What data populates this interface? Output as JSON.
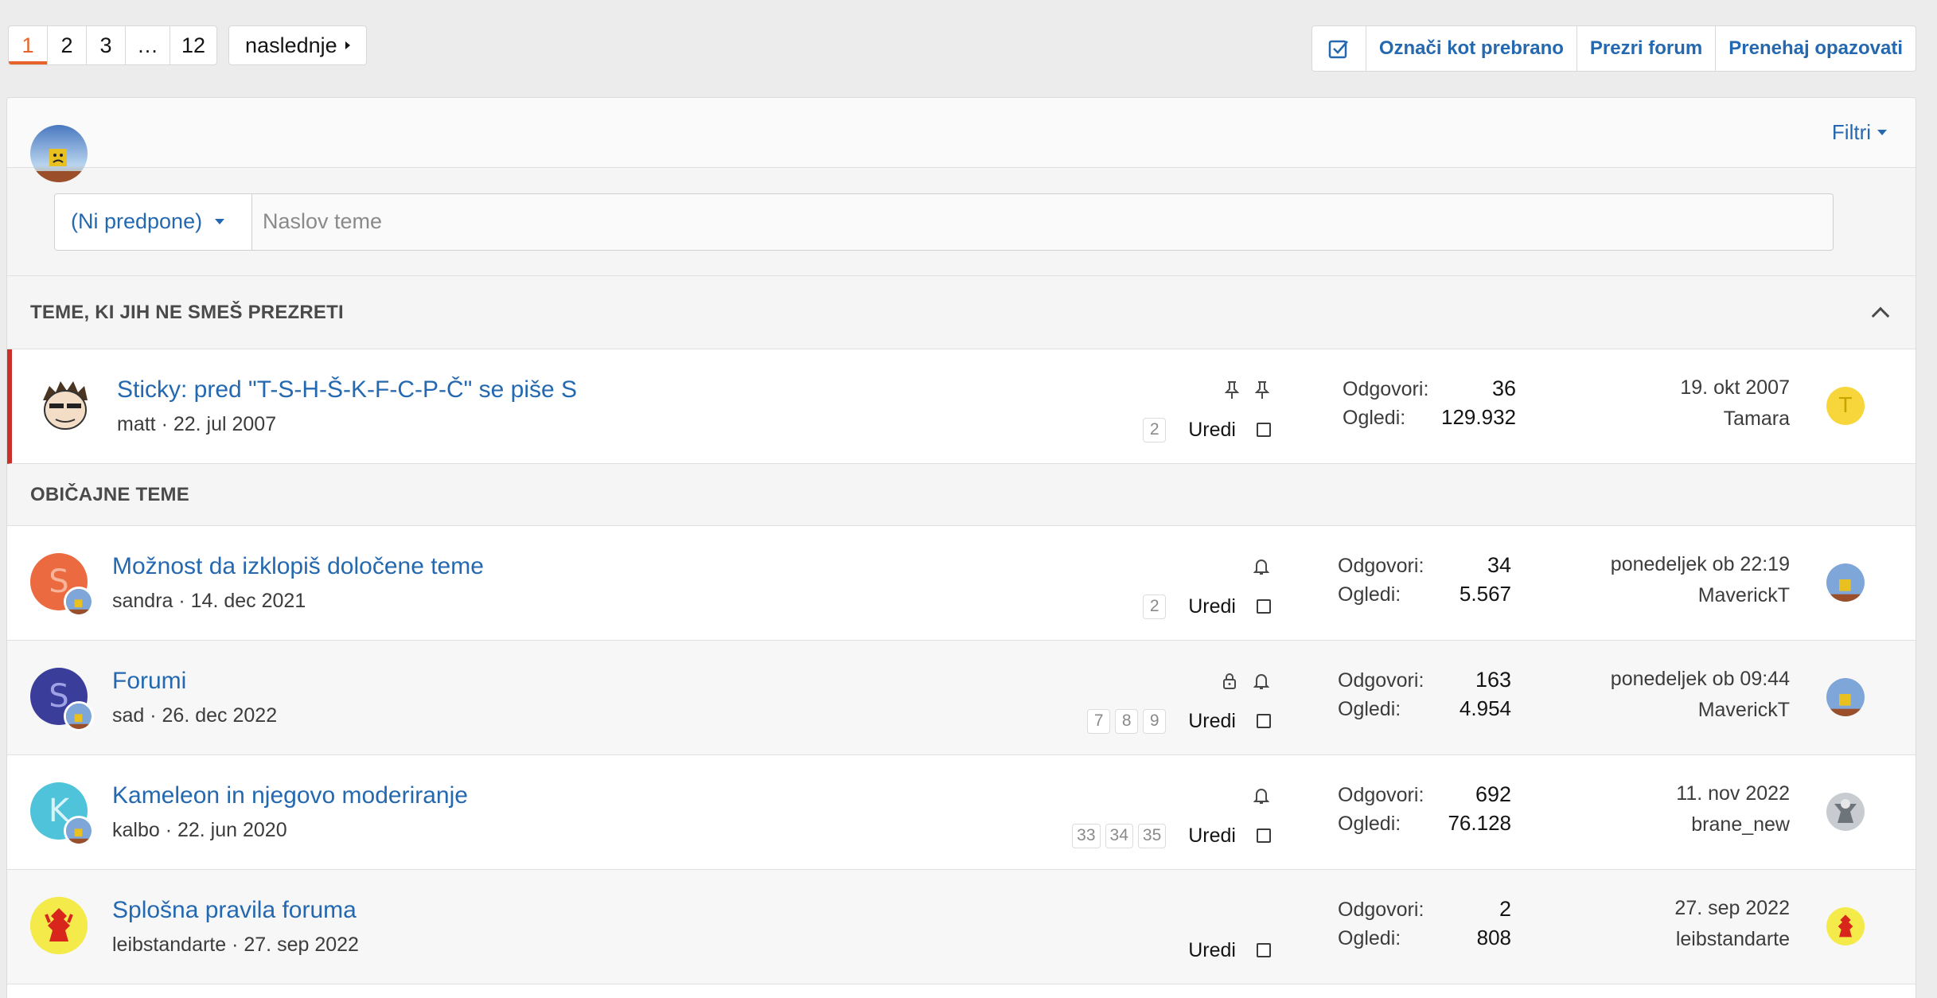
{
  "pagination": {
    "pages": [
      "1",
      "2",
      "3",
      "…",
      "12"
    ],
    "current": "1",
    "next_label": "naslednje"
  },
  "actions": {
    "mark_read": "Označi kot prebrano",
    "ignore_forum": "Prezri forum",
    "unwatch": "Prenehaj opazovati"
  },
  "filters_label": "Filtri",
  "quick_thread": {
    "prefix": "(Ni predpone)",
    "title_placeholder": "Naslov teme"
  },
  "sections": {
    "sticky_heading": "TEME, KI JIH NE SMEŠ PREZRETI",
    "normal_heading": "OBIČAJNE TEME"
  },
  "stat_labels": {
    "replies": "Odgovori:",
    "views": "Ogledi:"
  },
  "edit_label": "Uredi",
  "threads": [
    {
      "title": "Sticky: pred \"T-S-H-Š-K-F-C-P-Č\" se piše S",
      "author": "matt",
      "date": "22. jul 2007",
      "meta": "matt · 22. jul 2007",
      "pages": [
        "2"
      ],
      "replies": "36",
      "views": "129.932",
      "last_date": "19. okt 2007",
      "last_user": "Tamara",
      "last_avatar_letter": "T",
      "icons": [
        "pin-icon",
        "pin-icon"
      ]
    },
    {
      "title": "Možnost da izklopiš določene teme",
      "author": "sandra",
      "date": "14. dec 2021",
      "meta": "sandra · 14. dec 2021",
      "avatar_letter": "S",
      "avatar_color": "#ec6a3f",
      "pages": [
        "2"
      ],
      "replies": "34",
      "views": "5.567",
      "last_date": "ponedeljek ob 22:19",
      "last_user": "MaverickT",
      "icons": [
        "bell-icon"
      ]
    },
    {
      "title": "Forumi",
      "author": "sad",
      "date": "26. dec 2022",
      "meta": "sad · 26. dec 2022",
      "avatar_letter": "S",
      "avatar_color": "#3b3d9a",
      "pages": [
        "7",
        "8",
        "9"
      ],
      "replies": "163",
      "views": "4.954",
      "last_date": "ponedeljek ob 09:44",
      "last_user": "MaverickT",
      "icons": [
        "lock-icon",
        "bell-icon"
      ]
    },
    {
      "title": "Kameleon in njegovo moderiranje",
      "author": "kalbo",
      "date": "22. jun 2020",
      "meta": "kalbo · 22. jun 2020",
      "avatar_letter": "K",
      "avatar_color": "#4fc3d9",
      "pages": [
        "33",
        "34",
        "35"
      ],
      "replies": "692",
      "views": "76.128",
      "last_date": "11. nov 2022",
      "last_user": "brane_new",
      "icons": [
        "bell-icon"
      ]
    },
    {
      "title": "Splošna pravila foruma",
      "author": "leibstandarte",
      "date": "27. sep 2022",
      "meta": "leibstandarte · 27. sep 2022",
      "pages": [],
      "replies": "2",
      "views": "808",
      "last_date": "27. sep 2022",
      "last_user": "leibstandarte",
      "icons": []
    }
  ],
  "colors": {
    "link": "#2468b0",
    "accent": "#e8632b",
    "sticky_marker": "#c9302c"
  }
}
